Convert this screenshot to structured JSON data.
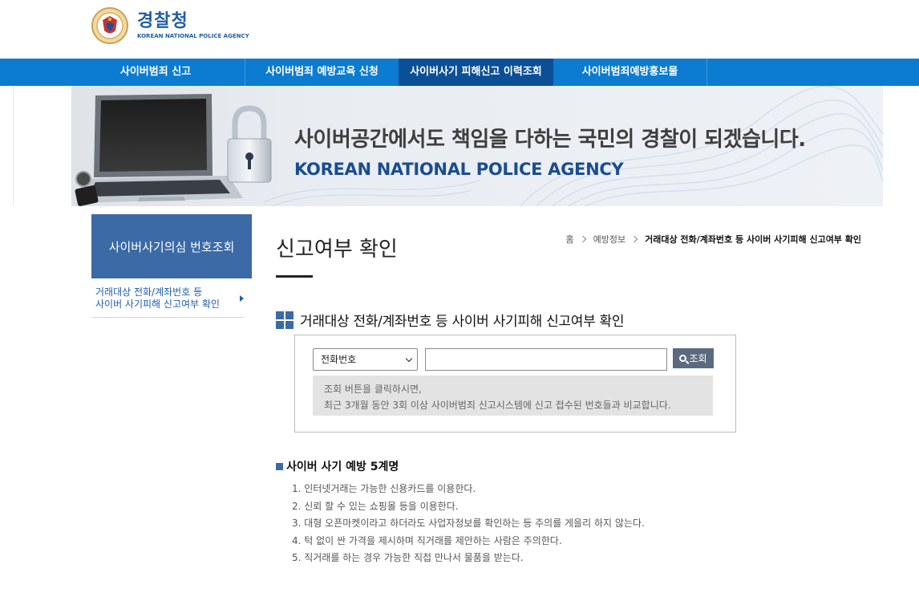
{
  "header": {
    "logo_kr": "경찰청",
    "logo_en": "KOREAN NATIONAL POLICE AGENCY"
  },
  "nav": {
    "items": [
      {
        "label": "사이버범죄 신고"
      },
      {
        "label": "사이버범죄 예방교육 신청"
      },
      {
        "label": "사이버사기 피해신고 이력조회"
      },
      {
        "label": "사이버범죄예방홍보물"
      }
    ],
    "active_index": 2
  },
  "banner": {
    "title": "사이버공간에서도 책임을 다하는 국민의 경찰이 되겠습니다.",
    "subtitle": "KOREAN NATIONAL POLICE AGENCY"
  },
  "sidebar": {
    "title": "사이버사기의심 번호조회",
    "items": [
      {
        "line1": "거래대상 전화/계좌번호 등",
        "line2": "사이버 사기피해 신고여부 확인"
      }
    ]
  },
  "page": {
    "title": "신고여부 확인",
    "breadcrumb": [
      "홈",
      "예방정보",
      "거래대상 전화/계좌번호 등 사이버 사기피해 신고여부 확인"
    ]
  },
  "search": {
    "heading": "거래대상 전화/계좌번호 등 사이버 사기피해 신고여부 확인",
    "type_selected": "전화번호",
    "input_value": "",
    "button_label": "조회",
    "notice_line1": "조회 버튼을 클릭하시면,",
    "notice_line2": "최근 3개월 동안 3회 이상 사이버범죄 신고시스템에 신고 접수된 번호들과 비교합니다."
  },
  "tips": {
    "heading": "사이버 사기 예방 5계명",
    "items": [
      "1. 인터넷거래는 가능한 신용카드를 이용한다.",
      "2. 신뢰 할 수 있는 쇼핑몰 등을 이용한다.",
      "3. 대형 오픈마켓이라고 하더라도 사업자정보를 확인하는 등 주의를 게을리 하지 않는다.",
      "4. 턱 없이 싼 가격을 제시하며 직거래를 제안하는 사람은 주의한다.",
      "5. 직거래를 하는 경우 가능한 직접 만나서 물품을 받는다."
    ]
  },
  "colors": {
    "nav_bg": "#0b7cd1",
    "nav_active": "#0b4f96",
    "sidebar_box": "#3b6aa7",
    "accent": "#1f5ea8",
    "button_bg": "#5b6b7f",
    "notice_bg": "#e3e3e3"
  },
  "icons": {
    "logo": "police-emblem-icon",
    "search": "magnifier-icon",
    "section": "grid-squares-icon",
    "lock": "padlock-icon",
    "laptop": "laptop-icon"
  }
}
